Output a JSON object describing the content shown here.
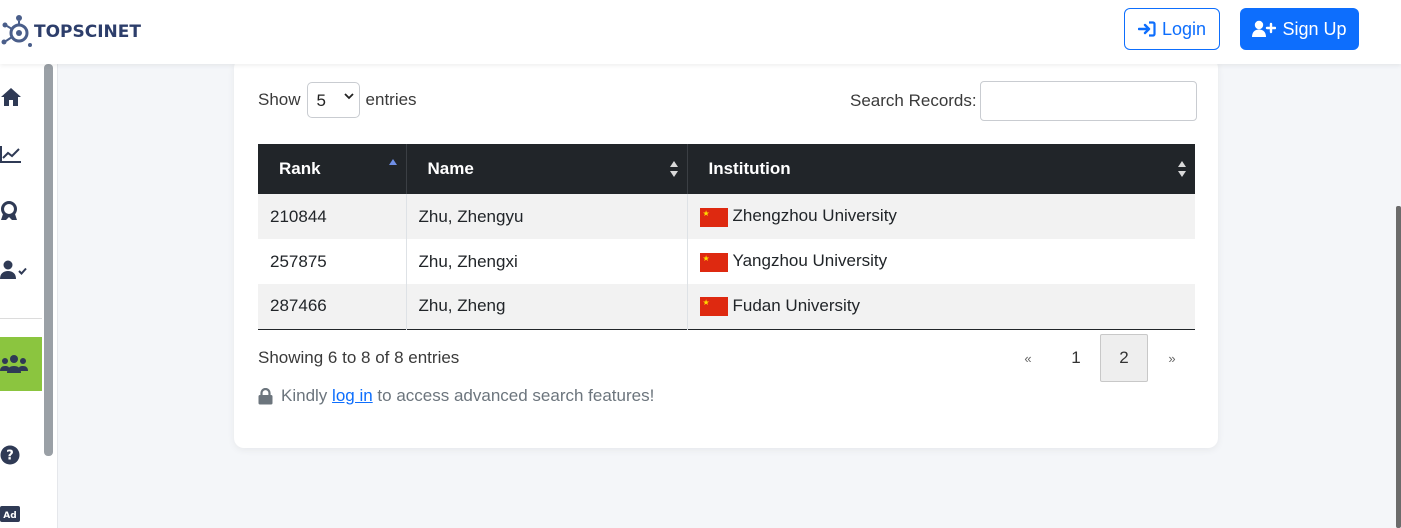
{
  "header": {
    "brand": "TOPSCINET",
    "login_label": "Login",
    "signup_label": "Sign Up"
  },
  "sidebar": {
    "items": [
      {
        "icon": "home-icon"
      },
      {
        "icon": "chart-line-icon"
      },
      {
        "icon": "award-icon"
      },
      {
        "icon": "user-check-icon"
      },
      {
        "icon": "users-icon",
        "active": true
      },
      {
        "icon": "question-icon"
      },
      {
        "icon": "ad-icon",
        "text": "Ad"
      }
    ]
  },
  "controls": {
    "show_label": "Show",
    "entries_value": "5",
    "entries_label": "entries",
    "search_label": "Search Records:",
    "search_value": ""
  },
  "table": {
    "headers": [
      "Rank",
      "Name",
      "Institution"
    ],
    "rows": [
      {
        "rank": "210844",
        "name": "Zhu, Zhengyu",
        "institution": "Zhengzhou University"
      },
      {
        "rank": "257875",
        "name": "Zhu, Zhengxi",
        "institution": "Yangzhou University"
      },
      {
        "rank": "287466",
        "name": "Zhu, Zheng",
        "institution": "Fudan University"
      }
    ]
  },
  "footer": {
    "info": "Showing 6 to 8 of 8 entries",
    "pager": {
      "prev": "«",
      "pages": [
        "1",
        "2"
      ],
      "current": "2",
      "next": "»"
    },
    "notice_pre": "Kindly",
    "notice_link": "log in",
    "notice_post": "to access advanced search features!"
  },
  "colors": {
    "accent": "#0d6efd",
    "active_sidebar": "#8bc53f",
    "table_header": "#212529"
  }
}
